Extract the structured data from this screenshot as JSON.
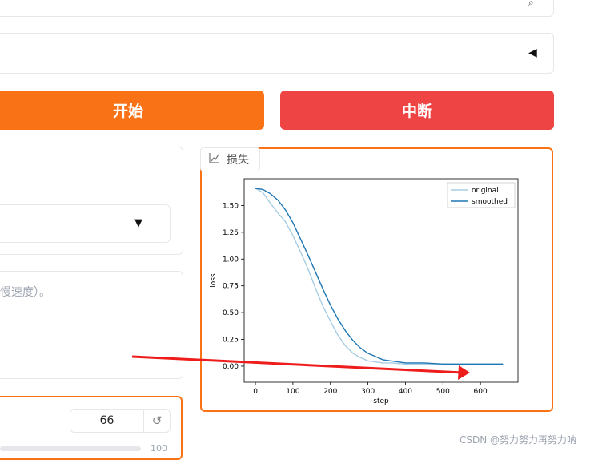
{
  "buttons": {
    "start_label": "开始",
    "stop_label": "中断"
  },
  "colors": {
    "orange": "#f97316",
    "red": "#ef4444",
    "plot_border": "#f97316"
  },
  "form": {
    "description_partial": "慢速度）。",
    "number_value": "66",
    "slider_max_label": "100"
  },
  "plot_panel": {
    "tab_label": "损失",
    "tab_icon": "chart-icon"
  },
  "chart_data": {
    "type": "line",
    "xlabel": "step",
    "ylabel": "loss",
    "xlim": [
      -30,
      700
    ],
    "ylim": [
      -0.15,
      1.75
    ],
    "xticks": [
      0,
      100,
      200,
      300,
      400,
      500,
      600
    ],
    "yticks": [
      0.0,
      0.25,
      0.5,
      0.75,
      1.0,
      1.25,
      1.5
    ],
    "legend_position": "top-right",
    "series": [
      {
        "name": "original",
        "color": "#a6cde3",
        "x": [
          0,
          20,
          40,
          60,
          80,
          100,
          120,
          140,
          160,
          180,
          200,
          220,
          240,
          260,
          280,
          300,
          320,
          340,
          360,
          400,
          450,
          500,
          550,
          600,
          650,
          660
        ],
        "y": [
          1.66,
          1.62,
          1.52,
          1.43,
          1.35,
          1.22,
          1.07,
          0.91,
          0.73,
          0.56,
          0.42,
          0.29,
          0.19,
          0.12,
          0.08,
          0.05,
          0.04,
          0.03,
          0.03,
          0.02,
          0.02,
          0.02,
          0.02,
          0.02,
          0.02,
          0.02
        ]
      },
      {
        "name": "smoothed",
        "color": "#1f77b4",
        "x": [
          0,
          20,
          40,
          60,
          80,
          100,
          120,
          140,
          160,
          180,
          200,
          220,
          240,
          260,
          280,
          300,
          320,
          340,
          360,
          380,
          400,
          420,
          450,
          500,
          550,
          600,
          650,
          660
        ],
        "y": [
          1.66,
          1.65,
          1.61,
          1.55,
          1.46,
          1.34,
          1.19,
          1.04,
          0.88,
          0.72,
          0.57,
          0.44,
          0.33,
          0.24,
          0.17,
          0.12,
          0.09,
          0.06,
          0.05,
          0.04,
          0.03,
          0.03,
          0.03,
          0.02,
          0.02,
          0.02,
          0.02,
          0.02
        ]
      }
    ]
  },
  "watermark": "CSDN @努力努力再努力呐"
}
